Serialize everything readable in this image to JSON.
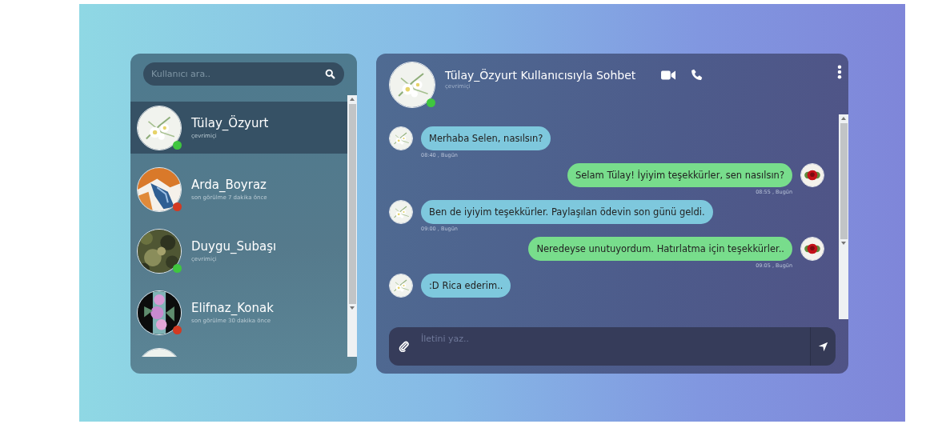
{
  "search": {
    "placeholder": "Kullanıcı ara.."
  },
  "contacts": [
    {
      "name": "Tülay_Özyurt",
      "status": "çevrimiçi",
      "online": true,
      "selected": true
    },
    {
      "name": "Arda_Boyraz",
      "status": "son görülme 7 dakika önce",
      "online": false,
      "selected": false
    },
    {
      "name": "Duygu_Subaşı",
      "status": "çevrimiçi",
      "online": true,
      "selected": false
    },
    {
      "name": "Elifnaz_Konak",
      "status": "son görülme 30 dakika önce",
      "online": false,
      "selected": false
    }
  ],
  "chat_header": {
    "title": "Tülay_Özyurt Kullanıcısıyla Sohbet",
    "status": "çevrimiçi",
    "online": true
  },
  "messages": [
    {
      "kind": "received",
      "text": "Merhaba Selen, nasılsın?",
      "time": "08:40 , Bugün"
    },
    {
      "kind": "sent",
      "text": "Selam Tülay! İyiyim teşekkürler, sen nasılsın?",
      "time": "08:55 , Bugün"
    },
    {
      "kind": "received",
      "text": "Ben de iyiyim teşekkürler. Paylaşılan ödevin son günü geldi.",
      "time": "09:00 , Bugün"
    },
    {
      "kind": "sent",
      "text": "Neredeyse unutuyordum. Hatırlatma için teşekkürler..",
      "time": "09:05 , Bugün"
    },
    {
      "kind": "received",
      "text": ":D Rica ederim.."
    }
  ],
  "composer": {
    "placeholder": "İletini yaz.."
  }
}
